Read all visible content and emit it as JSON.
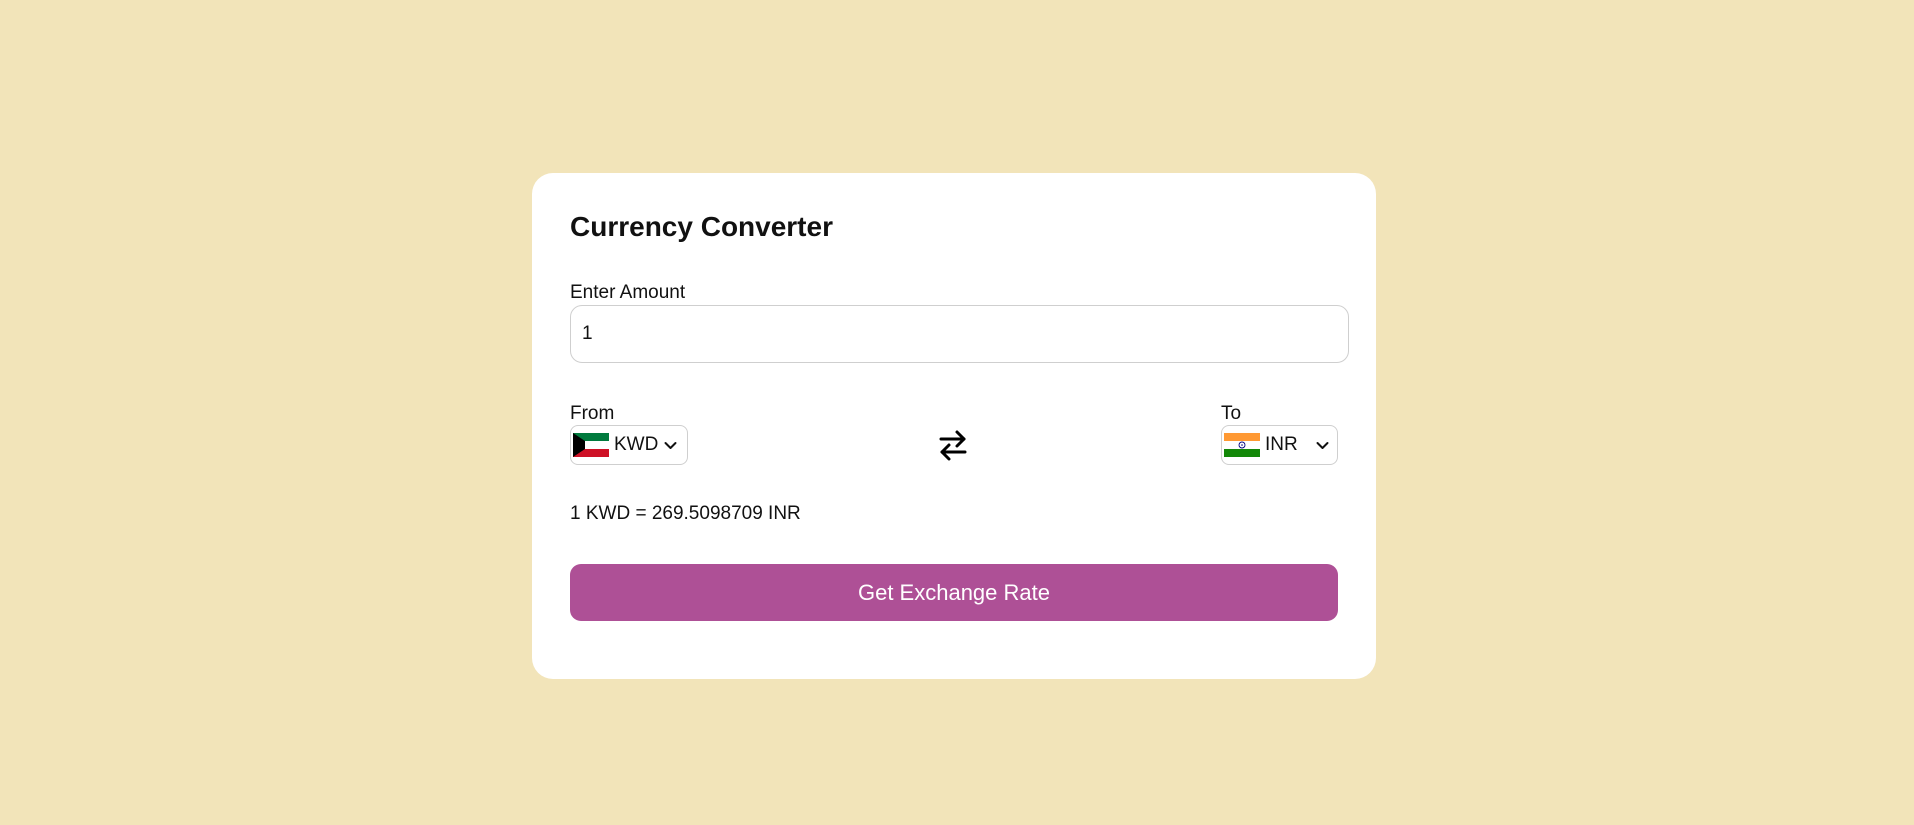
{
  "app": {
    "title": "Currency Converter"
  },
  "amount": {
    "label": "Enter Amount",
    "value": "1"
  },
  "from": {
    "label": "From",
    "currency": "KWD",
    "flag_icon": "kuwait-flag-icon"
  },
  "to": {
    "label": "To",
    "currency": "INR",
    "flag_icon": "india-flag-icon"
  },
  "swap": {
    "icon": "swap-arrows-icon"
  },
  "result": {
    "text": "1 KWD = 269.5098709 INR"
  },
  "action": {
    "button_label": "Get Exchange Rate"
  },
  "colors": {
    "page_background": "#f2e4b9",
    "card_background": "#ffffff",
    "button_background": "#ae5096",
    "button_text": "#ffffff"
  }
}
